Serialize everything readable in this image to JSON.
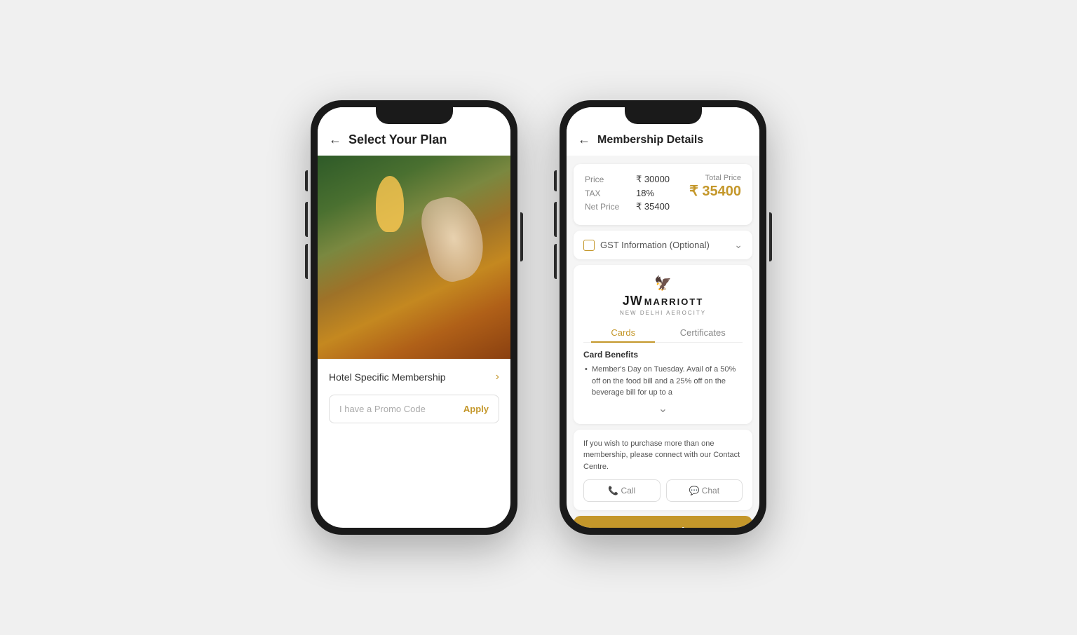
{
  "page": {
    "background": "#f0f0f0"
  },
  "phone1": {
    "header": {
      "back_label": "←",
      "title": "Select Your Plan"
    },
    "membership": {
      "label": "Hotel Specific Membership",
      "chevron": "›"
    },
    "promo": {
      "placeholder": "I have a Promo Code",
      "apply_label": "Apply"
    }
  },
  "phone2": {
    "header": {
      "back_label": "←",
      "title": "Membership Details"
    },
    "pricing": {
      "price_label": "Price",
      "price_value": "₹  30000",
      "tax_label": "TAX",
      "tax_value": "18%",
      "net_price_label": "Net Price",
      "net_price_value": "₹  35400",
      "total_price_label": "Total Price",
      "total_price_value": "₹  35400"
    },
    "gst": {
      "label": "GST Information (Optional)",
      "chevron": "⌄"
    },
    "hotel": {
      "bird": "🐦",
      "name_jw": "JW",
      "name_marriott": "MARRIOTT",
      "subtitle": "NEW DELHI AEROCITY"
    },
    "tabs": [
      {
        "label": "Cards",
        "active": true
      },
      {
        "label": "Certificates",
        "active": false
      }
    ],
    "benefits": {
      "title": "Card Benefits",
      "item": "Member's Day on Tuesday. Avail of a 50% off on the food bill and a 25% off on the beverage bill for up to a",
      "see_more": "⌄"
    },
    "contact": {
      "text": "If you wish to purchase more than one membership, please connect with our Contact Centre.",
      "call_label": "📞 Call",
      "chat_label": "💬 Chat"
    },
    "proceed": {
      "label": "Proceed"
    }
  }
}
